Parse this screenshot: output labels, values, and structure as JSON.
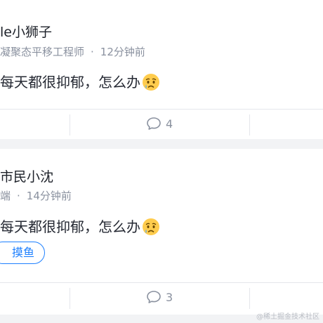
{
  "posts": [
    {
      "author": "le小狮子",
      "title": "凝聚态平移工程师",
      "separator": "·",
      "time": "12分钟前",
      "content": "每天都很抑郁，怎么办",
      "emoji": "crying-face-icon",
      "comments": "4"
    },
    {
      "author": "市民小沈",
      "title": "端",
      "separator": "·",
      "time": "14分钟前",
      "content": "每天都很抑郁，怎么办",
      "emoji": "crying-face-icon",
      "tag": "摸鱼",
      "comments": "3"
    }
  ],
  "watermark": "@稀土掘金技术社区",
  "colors": {
    "accent": "#1e80ff",
    "text_primary": "#1d2129",
    "text_secondary": "#8a919f",
    "background": "#f2f3f5"
  }
}
